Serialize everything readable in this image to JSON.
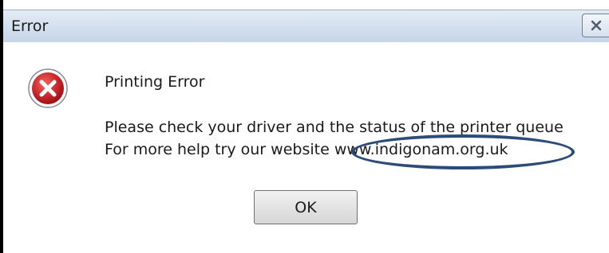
{
  "window": {
    "title": "Error"
  },
  "dialog": {
    "heading": "Printing Error",
    "message_line1": "Please check your driver and the status of the printer queue",
    "message_line2_prefix": "For more help try our website ",
    "link_text": "www.indigonam.org.uk",
    "ok_label": "OK",
    "icon": "error-icon"
  },
  "colors": {
    "annotation_ring": "#2d4b7a",
    "error_icon_red": "#c8252b"
  }
}
